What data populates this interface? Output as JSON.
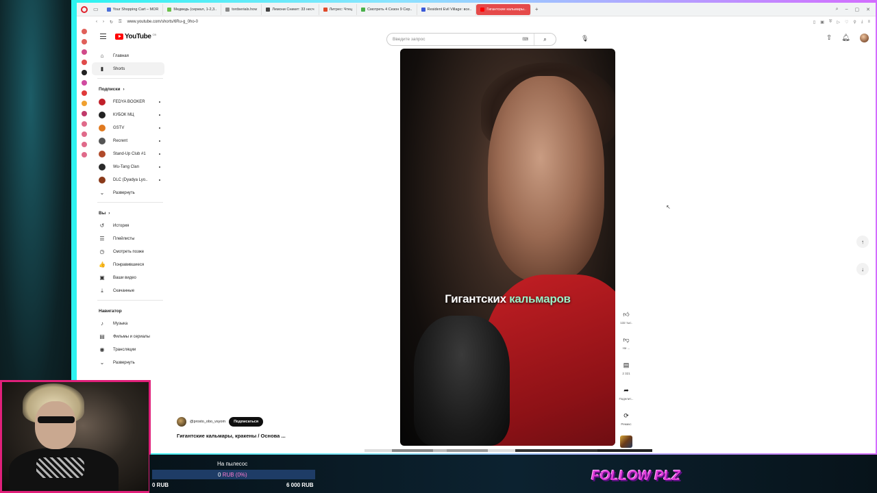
{
  "browser": {
    "tabs": [
      {
        "label": "Your Shopping Cart – MOR",
        "color": "#4a6fd8"
      },
      {
        "label": "Медведь (сериал, 1-2,3..",
        "color": "#6ac04a"
      },
      {
        "label": "tordserials.how",
        "color": "#888888"
      },
      {
        "label": "Лемони Сникет: 33 несч",
        "color": "#444444"
      },
      {
        "label": "Литрес: Чтец",
        "color": "#e04a2a"
      },
      {
        "label": "Смотреть 4 Сезон 9 Сер..",
        "color": "#4ab04a"
      },
      {
        "label": "Resident Evil Village: все..",
        "color": "#3a5ad8"
      },
      {
        "label": "Гигантские кальмары..",
        "color": "#ff0000",
        "active": true
      }
    ],
    "url": "www.youtube.com/shorts/6Ru-g_0ho-0"
  },
  "youtube": {
    "logo_text": "YouTube",
    "logo_country": "CB",
    "search_placeholder": "Введите запрос"
  },
  "sidebar": {
    "main": [
      {
        "label": "Главная",
        "icon": "home-icon",
        "glyph": "⌂"
      },
      {
        "label": "Shorts",
        "icon": "shorts-icon",
        "glyph": "▮",
        "active": true
      }
    ],
    "subs_title": "Подписки",
    "subscriptions": [
      {
        "label": "FEDYA BOOKER",
        "color": "#c0202a"
      },
      {
        "label": "КУБОК МЦ",
        "color": "#222222"
      },
      {
        "label": "GSTV",
        "color": "#e07a20"
      },
      {
        "label": "Recrent",
        "color": "#555555"
      },
      {
        "label": "Stand-Up Club #1",
        "color": "#b04a2a"
      },
      {
        "label": "Wu-Tang Clan",
        "color": "#2a2a2a"
      },
      {
        "label": "DLC (Dyadya Lyo..",
        "color": "#8a3a1a"
      }
    ],
    "expand_label": "Развернуть",
    "you_title": "Вы",
    "you_items": [
      {
        "label": "История",
        "icon": "history-icon",
        "glyph": "↺"
      },
      {
        "label": "Плейлисты",
        "icon": "playlist-icon",
        "glyph": "☰"
      },
      {
        "label": "Смотреть позже",
        "icon": "clock-icon",
        "glyph": "◷"
      },
      {
        "label": "Понравившиеся",
        "icon": "like-icon",
        "glyph": "👍"
      },
      {
        "label": "Ваши видео",
        "icon": "video-icon",
        "glyph": "▣"
      },
      {
        "label": "Скачанные",
        "icon": "download-icon",
        "glyph": "⤓"
      }
    ],
    "nav_title": "Навигатор",
    "nav_items": [
      {
        "label": "Музыка",
        "icon": "music-icon",
        "glyph": "♪"
      },
      {
        "label": "Фильмы и сериалы",
        "icon": "film-icon",
        "glyph": "▤"
      },
      {
        "label": "Трансляции",
        "icon": "live-icon",
        "glyph": "◉"
      },
      {
        "label": "Развернуть",
        "icon": "chevron-down-icon",
        "glyph": "⌄"
      }
    ]
  },
  "short": {
    "caption_white": "Гигантских",
    "caption_highlight": "кальмаров",
    "channel": "@prosto_obo_vsyom",
    "subscribe": "Подписаться",
    "title": "Гигантские кальмары, кракены / Основа ...",
    "likes": "132 тыс.",
    "dislike": "Не ...",
    "comments": "2 321",
    "share": "Поделит...",
    "remix": "Ремикс"
  },
  "donation": {
    "goal_title": "На пылесос",
    "current": "0",
    "current_unit": "RUB (0%)",
    "min": "0 RUB",
    "max": "6 000 RUB",
    "progress_fraction": 0.0,
    "follow_text": "FOLLOW PLZ"
  }
}
